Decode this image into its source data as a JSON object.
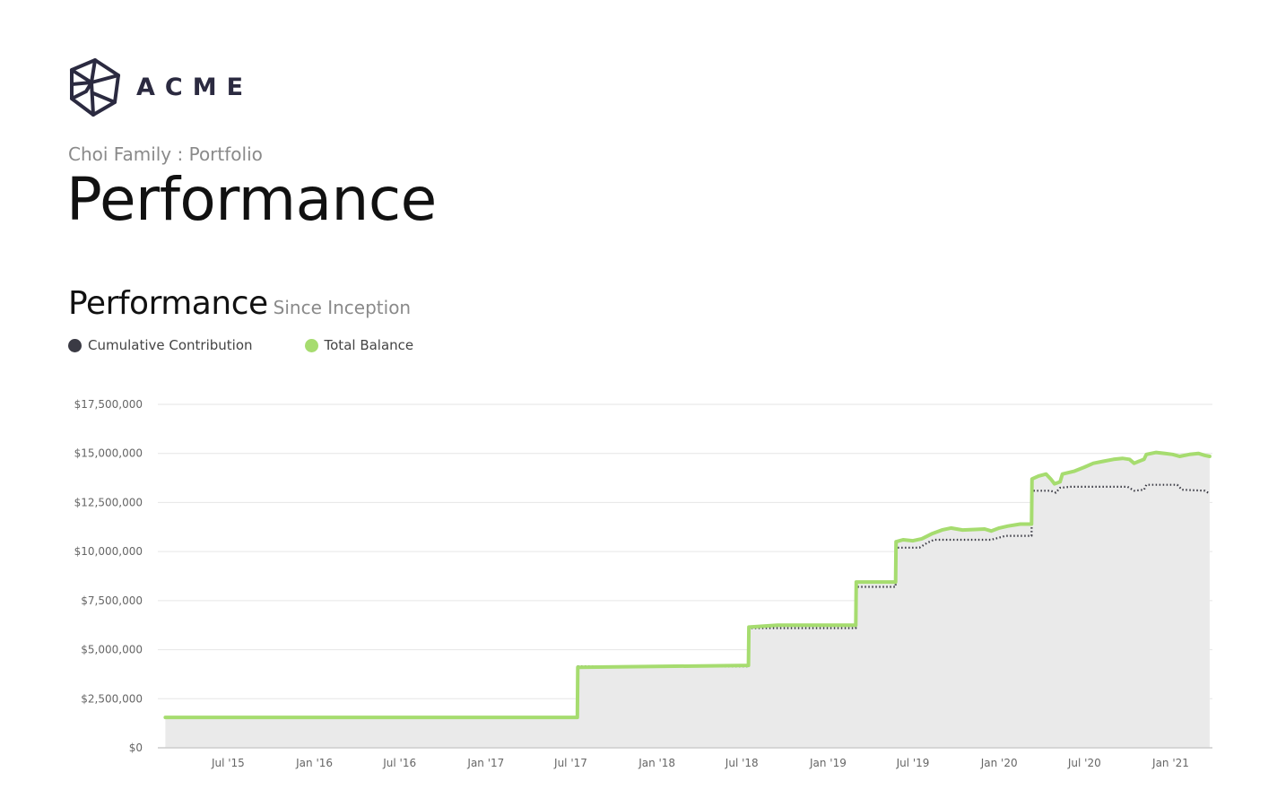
{
  "brand": {
    "name": "ACME",
    "logo_icon": "wireframe-cube-icon"
  },
  "breadcrumb": "Choi Family : Portfolio",
  "page_title": "Performance",
  "section": {
    "title": "Performance",
    "subtitle": "Since Inception"
  },
  "colors": {
    "contribution": "#3a3a44",
    "balance": "#a6dc6f",
    "area": "#eaeaea",
    "grid": "#e6e6e6",
    "axis": "#cccccc"
  },
  "chart_data": {
    "type": "line",
    "title": "",
    "xlabel": "",
    "ylabel": "",
    "ylim": [
      0,
      17500000
    ],
    "xlim": [
      "2015-02-01",
      "2021-03-31"
    ],
    "y_ticks": [
      0,
      2500000,
      5000000,
      7500000,
      10000000,
      12500000,
      15000000,
      17500000
    ],
    "y_tick_labels": [
      "$0",
      "$2,500,000",
      "$5,000,000",
      "$7,500,000",
      "$10,000,000",
      "$12,500,000",
      "$15,000,000",
      "$17,500,000"
    ],
    "x_ticks": [
      "2015-07-01",
      "2016-01-01",
      "2016-07-01",
      "2017-01-01",
      "2017-07-01",
      "2018-01-01",
      "2018-07-01",
      "2019-01-01",
      "2019-07-01",
      "2020-01-01",
      "2020-07-01",
      "2021-01-01"
    ],
    "x_tick_labels": [
      "Jul '15",
      "Jan '16",
      "Jul '16",
      "Jan '17",
      "Jul '17",
      "Jan '18",
      "Jul '18",
      "Jan '19",
      "Jul '19",
      "Jan '20",
      "Jul '20",
      "Jan '21"
    ],
    "grid": true,
    "legend": "top-left",
    "series": [
      {
        "name": "Cumulative Contribution",
        "style": "dotted",
        "points": [
          [
            "2015-02-17",
            1550000
          ],
          [
            "2017-07-15",
            1550000
          ],
          [
            "2017-07-16",
            4150000
          ],
          [
            "2018-07-15",
            4150000
          ],
          [
            "2018-07-16",
            6100000
          ],
          [
            "2019-03-01",
            6100000
          ],
          [
            "2019-03-02",
            8200000
          ],
          [
            "2019-05-25",
            8200000
          ],
          [
            "2019-05-26",
            10200000
          ],
          [
            "2019-07-15",
            10200000
          ],
          [
            "2019-08-01",
            10450000
          ],
          [
            "2019-08-15",
            10600000
          ],
          [
            "2019-12-15",
            10600000
          ],
          [
            "2020-01-15",
            10800000
          ],
          [
            "2020-03-10",
            10800000
          ],
          [
            "2020-03-11",
            13100000
          ],
          [
            "2020-04-20",
            13100000
          ],
          [
            "2020-05-01",
            13000000
          ],
          [
            "2020-05-10",
            13250000
          ],
          [
            "2020-06-01",
            13300000
          ],
          [
            "2020-10-01",
            13300000
          ],
          [
            "2020-10-15",
            13100000
          ],
          [
            "2020-11-05",
            13150000
          ],
          [
            "2020-11-10",
            13400000
          ],
          [
            "2021-01-15",
            13400000
          ],
          [
            "2021-01-25",
            13150000
          ],
          [
            "2021-03-15",
            13100000
          ],
          [
            "2021-03-25",
            12950000
          ]
        ]
      },
      {
        "name": "Total Balance",
        "style": "solid",
        "points": [
          [
            "2015-02-17",
            1550000
          ],
          [
            "2017-07-15",
            1550000
          ],
          [
            "2017-07-16",
            4100000
          ],
          [
            "2018-07-15",
            4200000
          ],
          [
            "2018-07-16",
            6150000
          ],
          [
            "2018-09-15",
            6250000
          ],
          [
            "2019-03-01",
            6250000
          ],
          [
            "2019-03-02",
            8450000
          ],
          [
            "2019-05-25",
            8450000
          ],
          [
            "2019-05-26",
            10500000
          ],
          [
            "2019-06-10",
            10600000
          ],
          [
            "2019-07-01",
            10550000
          ],
          [
            "2019-07-20",
            10650000
          ],
          [
            "2019-08-10",
            10900000
          ],
          [
            "2019-09-01",
            11100000
          ],
          [
            "2019-09-20",
            11200000
          ],
          [
            "2019-10-15",
            11100000
          ],
          [
            "2019-12-01",
            11150000
          ],
          [
            "2019-12-15",
            11050000
          ],
          [
            "2020-01-01",
            11200000
          ],
          [
            "2020-01-20",
            11300000
          ],
          [
            "2020-02-15",
            11400000
          ],
          [
            "2020-03-10",
            11400000
          ],
          [
            "2020-03-11",
            13700000
          ],
          [
            "2020-03-25",
            13850000
          ],
          [
            "2020-04-10",
            13950000
          ],
          [
            "2020-04-20",
            13700000
          ],
          [
            "2020-04-28",
            13450000
          ],
          [
            "2020-05-10",
            13550000
          ],
          [
            "2020-05-15",
            13950000
          ],
          [
            "2020-06-10",
            14100000
          ],
          [
            "2020-07-01",
            14300000
          ],
          [
            "2020-07-20",
            14500000
          ],
          [
            "2020-08-10",
            14600000
          ],
          [
            "2020-09-01",
            14700000
          ],
          [
            "2020-09-20",
            14750000
          ],
          [
            "2020-10-05",
            14700000
          ],
          [
            "2020-10-15",
            14500000
          ],
          [
            "2020-10-25",
            14600000
          ],
          [
            "2020-11-05",
            14700000
          ],
          [
            "2020-11-10",
            14950000
          ],
          [
            "2020-12-01",
            15050000
          ],
          [
            "2020-12-20",
            15000000
          ],
          [
            "2021-01-05",
            14950000
          ],
          [
            "2021-01-20",
            14850000
          ],
          [
            "2021-02-10",
            14950000
          ],
          [
            "2021-03-01",
            15000000
          ],
          [
            "2021-03-15",
            14900000
          ],
          [
            "2021-03-25",
            14850000
          ]
        ]
      }
    ]
  }
}
